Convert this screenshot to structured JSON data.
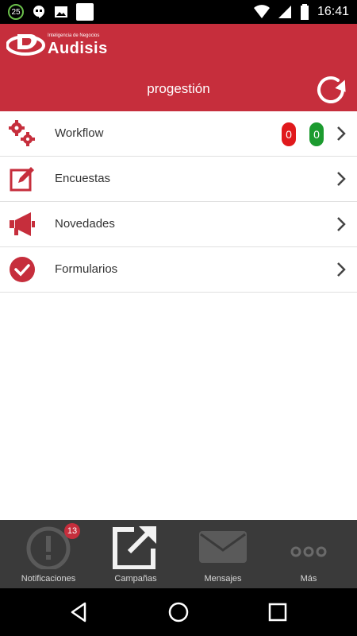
{
  "status_bar": {
    "badge": "25",
    "time": "16:41"
  },
  "header": {
    "brand_tagline": "Inteligencia de Negocios",
    "brand_name": "Audisis",
    "title": "progestión",
    "accent_color": "#c62e3c"
  },
  "menu": {
    "items": [
      {
        "label": "Workflow",
        "icon": "gears-icon",
        "counts": {
          "red": "0",
          "green": "0"
        }
      },
      {
        "label": "Encuestas",
        "icon": "edit-icon"
      },
      {
        "label": "Novedades",
        "icon": "megaphone-icon"
      },
      {
        "label": "Formularios",
        "icon": "check-circle-icon"
      }
    ]
  },
  "tabbar": {
    "tabs": [
      {
        "label": "Notificaciones",
        "icon": "alert-icon",
        "badge": "13"
      },
      {
        "label": "Campañas",
        "icon": "external-link-icon"
      },
      {
        "label": "Mensajes",
        "icon": "envelope-icon"
      },
      {
        "label": "Más",
        "icon": "more-icon"
      }
    ]
  }
}
